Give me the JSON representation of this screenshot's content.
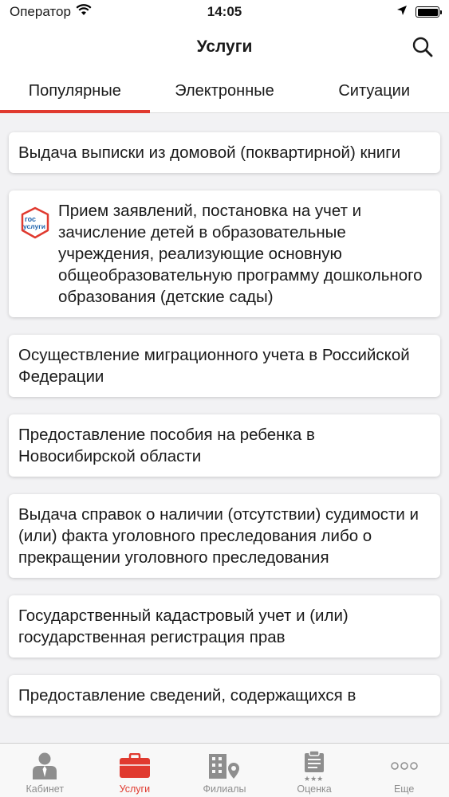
{
  "status_bar": {
    "carrier": "Оператор",
    "time": "14:05"
  },
  "nav": {
    "title": "Услуги"
  },
  "tabs": [
    {
      "label": "Популярные",
      "active": true
    },
    {
      "label": "Электронные",
      "active": false
    },
    {
      "label": "Ситуации",
      "active": false
    }
  ],
  "services": [
    {
      "text": "Выдача выписки из домовой (поквартирной) книги"
    },
    {
      "text": "Прием заявлений, постановка на учет и зачисление детей в образовательные учреждения, реализующие основную общеобразовательную программу дошкольного образования (детские сады)",
      "logo_line1": "гос",
      "logo_line2": "услуги"
    },
    {
      "text": "Осуществление миграционного учета в Российской Федерации"
    },
    {
      "text": "Предоставление пособия на ребенка в Новосибирской области"
    },
    {
      "text": "Выдача справок о наличии (отсутствии) судимости и (или) факта уголовного преследования либо о прекращении уголовного преследования"
    },
    {
      "text": "Государственный кадастровый учет и (или) государственная регистрация прав"
    },
    {
      "text": "Предоставление сведений, содержащихся в"
    }
  ],
  "tabbar": [
    {
      "label": "Кабинет",
      "icon": "person-icon"
    },
    {
      "label": "Услуги",
      "icon": "briefcase-icon",
      "active": true
    },
    {
      "label": "Филиалы",
      "icon": "building-pin-icon"
    },
    {
      "label": "Оценка",
      "icon": "clipboard-stars-icon"
    },
    {
      "label": "Еще",
      "icon": "more-dots-icon"
    }
  ],
  "colors": {
    "accent": "#e03a2f",
    "gos_blue": "#1f63ad",
    "gos_red": "#e03a2f",
    "inactive": "#8e8e8e"
  }
}
